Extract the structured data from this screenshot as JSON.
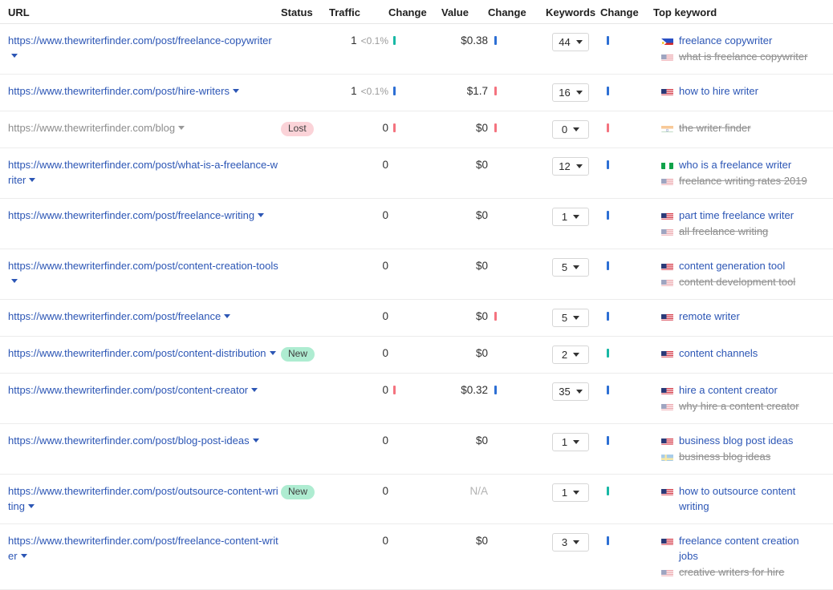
{
  "table": {
    "columns": [
      {
        "key": "url",
        "label": "URL"
      },
      {
        "key": "status",
        "label": "Status"
      },
      {
        "key": "traffic",
        "label": "Traffic"
      },
      {
        "key": "change1",
        "label": "Change"
      },
      {
        "key": "value",
        "label": "Value"
      },
      {
        "key": "change2",
        "label": "Change"
      },
      {
        "key": "keywords",
        "label": "Keywords"
      },
      {
        "key": "change3",
        "label": "Change"
      },
      {
        "key": "topkw",
        "label": "Top keyword"
      }
    ],
    "rows": [
      {
        "url": "https://www.thewriterfinder.com/post/freelance-copywriter",
        "url_lost": false,
        "status": "",
        "traffic": "1",
        "traffic_pct": "<0.1%",
        "change1": "up",
        "value": "$0.38",
        "change2": "blue",
        "keywords": "44",
        "change3": "blue",
        "top_keywords": [
          {
            "text": "freelance copywriter",
            "flag": "ph",
            "lost": false
          },
          {
            "text": "what is freelance copywriter",
            "flag": "us",
            "lost": true
          }
        ]
      },
      {
        "url": "https://www.thewriterfinder.com/post/hire-writers",
        "url_lost": false,
        "status": "",
        "traffic": "1",
        "traffic_pct": "<0.1%",
        "change1": "blue",
        "value": "$1.7",
        "change2": "down",
        "keywords": "16",
        "change3": "blue",
        "top_keywords": [
          {
            "text": "how to hire writer",
            "flag": "us",
            "lost": false
          }
        ]
      },
      {
        "url": "https://www.thewriterfinder.com/blog",
        "url_lost": true,
        "status": "Lost",
        "traffic": "0",
        "traffic_pct": "",
        "change1": "down",
        "value": "$0",
        "change2": "down",
        "keywords": "0",
        "change3": "down",
        "top_keywords": [
          {
            "text": "the writer finder",
            "flag": "in",
            "lost": true
          }
        ]
      },
      {
        "url": "https://www.thewriterfinder.com/post/what-is-a-freelance-writer",
        "url_lost": false,
        "status": "",
        "traffic": "0",
        "traffic_pct": "",
        "change1": "none",
        "value": "$0",
        "change2": "none",
        "keywords": "12",
        "change3": "blue",
        "top_keywords": [
          {
            "text": "who is a freelance writer",
            "flag": "ng",
            "lost": false
          },
          {
            "text": "freelance writing rates 2019",
            "flag": "us",
            "lost": true
          }
        ]
      },
      {
        "url": "https://www.thewriterfinder.com/post/freelance-writing",
        "url_lost": false,
        "status": "",
        "traffic": "0",
        "traffic_pct": "",
        "change1": "none",
        "value": "$0",
        "change2": "none",
        "keywords": "1",
        "change3": "blue",
        "top_keywords": [
          {
            "text": "part time freelance writer",
            "flag": "us",
            "lost": false
          },
          {
            "text": "all freelance writing",
            "flag": "us",
            "lost": true
          }
        ]
      },
      {
        "url": "https://www.thewriterfinder.com/post/content-creation-tools",
        "url_lost": false,
        "status": "",
        "traffic": "0",
        "traffic_pct": "",
        "change1": "none",
        "value": "$0",
        "change2": "none",
        "keywords": "5",
        "change3": "blue",
        "top_keywords": [
          {
            "text": "content generation tool",
            "flag": "us",
            "lost": false
          },
          {
            "text": "content development tool",
            "flag": "us",
            "lost": true
          }
        ]
      },
      {
        "url": "https://www.thewriterfinder.com/post/freelance",
        "url_lost": false,
        "status": "",
        "traffic": "0",
        "traffic_pct": "",
        "change1": "none",
        "value": "$0",
        "change2": "down",
        "keywords": "5",
        "change3": "blue",
        "top_keywords": [
          {
            "text": "remote writer",
            "flag": "us",
            "lost": false
          }
        ]
      },
      {
        "url": "https://www.thewriterfinder.com/post/content-distribution",
        "url_lost": false,
        "status": "New",
        "traffic": "0",
        "traffic_pct": "",
        "change1": "none",
        "value": "$0",
        "change2": "none",
        "keywords": "2",
        "change3": "up",
        "top_keywords": [
          {
            "text": "content channels",
            "flag": "us",
            "lost": false
          }
        ]
      },
      {
        "url": "https://www.thewriterfinder.com/post/content-creator",
        "url_lost": false,
        "status": "",
        "traffic": "0",
        "traffic_pct": "",
        "change1": "down",
        "value": "$0.32",
        "change2": "blue",
        "keywords": "35",
        "change3": "blue",
        "top_keywords": [
          {
            "text": "hire a content creator",
            "flag": "us",
            "lost": false
          },
          {
            "text": "why hire a content creator",
            "flag": "us",
            "lost": true
          }
        ]
      },
      {
        "url": "https://www.thewriterfinder.com/post/blog-post-ideas",
        "url_lost": false,
        "status": "",
        "traffic": "0",
        "traffic_pct": "",
        "change1": "none",
        "value": "$0",
        "change2": "none",
        "keywords": "1",
        "change3": "blue",
        "top_keywords": [
          {
            "text": "business blog post ideas",
            "flag": "us",
            "lost": false
          },
          {
            "text": "business blog ideas",
            "flag": "se",
            "lost": true
          }
        ]
      },
      {
        "url": "https://www.thewriterfinder.com/post/outsource-content-writing",
        "url_lost": false,
        "status": "New",
        "traffic": "0",
        "traffic_pct": "",
        "change1": "none",
        "value": "N/A",
        "value_na": true,
        "change2": "none",
        "keywords": "1",
        "change3": "up",
        "top_keywords": [
          {
            "text": "how to outsource content writing",
            "flag": "us",
            "lost": false
          }
        ]
      },
      {
        "url": "https://www.thewriterfinder.com/post/freelance-content-writer",
        "url_lost": false,
        "status": "",
        "traffic": "0",
        "traffic_pct": "",
        "change1": "none",
        "value": "$0",
        "change2": "none",
        "keywords": "3",
        "change3": "blue",
        "top_keywords": [
          {
            "text": "freelance content creation jobs",
            "flag": "us",
            "lost": false
          },
          {
            "text": "creative writers for hire",
            "flag": "us",
            "lost": true
          }
        ]
      }
    ]
  },
  "colors": {
    "link": "#2c56b5",
    "lost_badge_bg": "#fbd3d8",
    "new_badge_bg": "#aeecd1",
    "tick_up": "#18b8a5",
    "tick_blue": "#2d6fd4",
    "tick_down": "#f4737f",
    "muted_text": "#8a8a8a"
  }
}
